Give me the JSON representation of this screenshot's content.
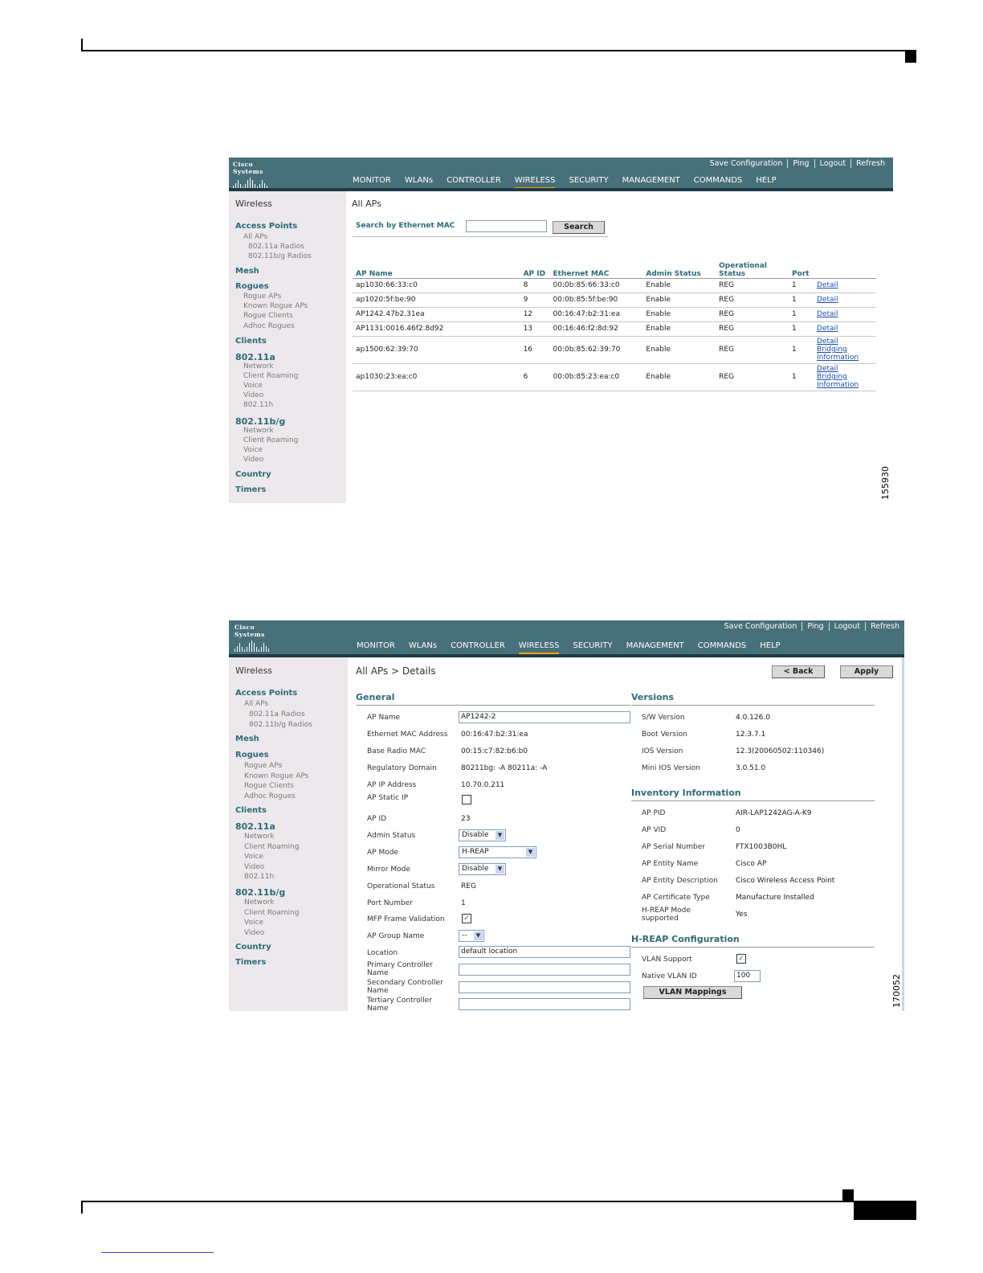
{
  "screen1": {
    "brand": "Cisco Systems",
    "top_links": [
      "Save Configuration",
      "Ping",
      "Logout",
      "Refresh"
    ],
    "nav": [
      "MONITOR",
      "WLANs",
      "CONTROLLER",
      "WIRELESS",
      "SECURITY",
      "MANAGEMENT",
      "COMMANDS",
      "HELP"
    ],
    "active_nav": "WIRELESS",
    "sidebar": {
      "heading": "Wireless",
      "access_points": "Access Points",
      "all_aps": "All APs",
      "radio_a": "802.11a Radios",
      "radio_bg": "802.11b/g Radios",
      "mesh": "Mesh",
      "rogues": "Rogues",
      "rogue_aps": "Rogue APs",
      "known_rogue_aps": "Known Rogue APs",
      "rogue_clients": "Rogue Clients",
      "adhoc_rogues": "Adhoc Rogues",
      "clients": "Clients",
      "a": "802.11a",
      "a_items": [
        "Network",
        "Client Roaming",
        "Voice",
        "Video",
        "802.11h"
      ],
      "bg": "802.11b/g",
      "bg_items": [
        "Network",
        "Client Roaming",
        "Voice",
        "Video"
      ],
      "country": "Country",
      "timers": "Timers"
    },
    "page_title": "All APs",
    "search_label": "Search by Ethernet MAC",
    "search_value": "",
    "search_button": "Search",
    "headers": [
      "AP Name",
      "AP ID",
      "Ethernet MAC",
      "Admin Status",
      "Operational Status",
      "Port"
    ],
    "rows": [
      {
        "name": "ap1030:66:33:c0",
        "id": "8",
        "mac": "00:0b:85:66:33:c0",
        "admin": "Enable",
        "op": "REG",
        "port": "1",
        "links": [
          "Detail"
        ]
      },
      {
        "name": "ap1020:5f:be:90",
        "id": "9",
        "mac": "00:0b:85:5f:be:90",
        "admin": "Enable",
        "op": "REG",
        "port": "1",
        "links": [
          "Detail"
        ]
      },
      {
        "name": "AP1242.47b2.31ea",
        "id": "12",
        "mac": "00:16:47:b2:31:ea",
        "admin": "Enable",
        "op": "REG",
        "port": "1",
        "links": [
          "Detail"
        ]
      },
      {
        "name": "AP1131:0016.46f2.8d92",
        "id": "13",
        "mac": "00:16:46:f2:8d:92",
        "admin": "Enable",
        "op": "REG",
        "port": "1",
        "links": [
          "Detail"
        ]
      },
      {
        "name": "ap1500:62:39:70",
        "id": "16",
        "mac": "00:0b:85:62:39:70",
        "admin": "Enable",
        "op": "REG",
        "port": "1",
        "links": [
          "Detail",
          "Bridging",
          "Information"
        ]
      },
      {
        "name": "ap1030:23:ea:c0",
        "id": "6",
        "mac": "00:0b:85:23:ea:c0",
        "admin": "Enable",
        "op": "REG",
        "port": "1",
        "links": [
          "Detail",
          "Bridging",
          "Information"
        ]
      }
    ],
    "figure_id": "155930"
  },
  "screen2": {
    "brand": "Cisco Systems",
    "top_links": [
      "Save Configuration",
      "Ping",
      "Logout",
      "Refresh"
    ],
    "nav": [
      "MONITOR",
      "WLANs",
      "CONTROLLER",
      "WIRELESS",
      "SECURITY",
      "MANAGEMENT",
      "COMMANDS",
      "HELP"
    ],
    "active_nav": "WIRELESS",
    "page_title": "All APs > Details",
    "back_button": "< Back",
    "apply_button": "Apply",
    "general": {
      "heading": "General",
      "ap_name_label": "AP Name",
      "ap_name": "AP1242-2",
      "eth_mac_label": "Ethernet MAC Address",
      "eth_mac": "00:16:47:b2:31:ea",
      "base_mac_label": "Base Radio MAC",
      "base_mac": "00:15:c7:82:b6:b0",
      "reg_domain_label": "Regulatory Domain",
      "reg_domain": "80211bg: -A 80211a: -A",
      "ip_label": "AP IP Address",
      "ip": "10.70.0.211",
      "static_ip_label": "AP Static IP",
      "ap_id_label": "AP ID",
      "ap_id": "23",
      "admin_label": "Admin Status",
      "admin": "Disable",
      "mode_label": "AP Mode",
      "mode": "H-REAP",
      "mirror_label": "Mirror Mode",
      "mirror": "Disable",
      "op_label": "Operational Status",
      "op": "REG",
      "port_label": "Port Number",
      "port": "1",
      "mfp_label": "MFP Frame Validation",
      "group_label": "AP Group Name",
      "group": "--",
      "location_label": "Location",
      "location": "default location",
      "primary_label": "Primary Controller Name",
      "secondary_label": "Secondary Controller Name",
      "tertiary_label": "Tertiary Controller Name"
    },
    "versions": {
      "heading": "Versions",
      "sw_label": "S/W Version",
      "sw": "4.0.126.0",
      "boot_label": "Boot Version",
      "boot": "12.3.7.1",
      "ios_label": "IOS Version",
      "ios": "12.3(20060502:110346)",
      "mini_label": "Mini IOS Version",
      "mini": "3.0.51.0"
    },
    "inventory": {
      "heading": "Inventory Information",
      "pid_label": "AP PID",
      "pid": "AIR-LAP1242AG-A-K9",
      "vid_label": "AP VID",
      "vid": "0",
      "serial_label": "AP Serial Number",
      "serial": "FTX1003B0HL",
      "entity_label": "AP Entity Name",
      "entity": "Cisco AP",
      "desc_label": "AP Entity Description",
      "desc": "Cisco Wireless Access Point",
      "cert_label": "AP Certificate Type",
      "cert": "Manufacture Installed",
      "hreap_label": "H-REAP Mode supported",
      "hreap": "Yes"
    },
    "hreap_config": {
      "heading": "H-REAP Configuration",
      "vlan_support_label": "VLAN Support",
      "native_vlan_label": "Native VLAN ID",
      "native_vlan": "100",
      "vlan_mappings_button": "VLAN Mappings"
    },
    "figure_id": "170052"
  }
}
